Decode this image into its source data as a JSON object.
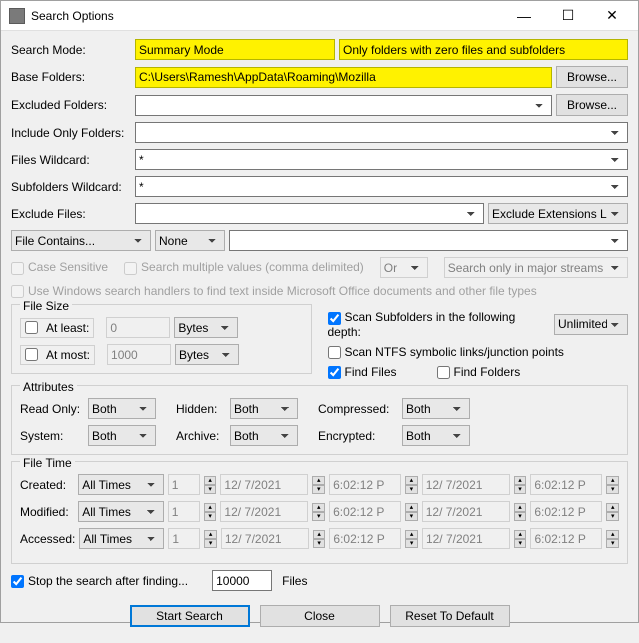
{
  "window": {
    "title": "Search Options"
  },
  "labels": {
    "search_mode": "Search Mode:",
    "base_folders": "Base Folders:",
    "excluded_folders": "Excluded Folders:",
    "include_only": "Include Only Folders:",
    "files_wildcard": "Files Wildcard:",
    "subfolders_wildcard": "Subfolders Wildcard:",
    "exclude_files": "Exclude Files:"
  },
  "search_mode": {
    "value": "Summary Mode",
    "filter": "Only folders with zero files and subfolders"
  },
  "base": {
    "path": "C:\\Users\\Ramesh\\AppData\\Roaming\\Mozilla",
    "browse": "Browse..."
  },
  "excluded": {
    "value": "",
    "browse": "Browse..."
  },
  "include_only": {
    "value": ""
  },
  "files_wildcard": {
    "value": "*"
  },
  "subfolders_wildcard": {
    "value": "*"
  },
  "exclude_files": {
    "value": "",
    "ext_list": "Exclude Extensions List"
  },
  "file_contains": {
    "label": "File Contains...",
    "match": "None",
    "value": ""
  },
  "opts": {
    "case_sensitive": "Case Sensitive",
    "multi_values": "Search multiple values (comma delimited)",
    "or": "Or",
    "major_streams": "Search only in major streams",
    "use_handlers": "Use Windows search handlers to find text inside Microsoft Office documents and other file types"
  },
  "filesize": {
    "legend": "File Size",
    "at_least": "At least:",
    "at_most": "At most:",
    "least_val": "0",
    "most_val": "1000",
    "unit": "Bytes"
  },
  "scan": {
    "subfolders": "Scan Subfolders in the following depth:",
    "depth": "Unlimited",
    "ntfs": "Scan NTFS symbolic links/junction points",
    "find_files": "Find Files",
    "find_folders": "Find Folders"
  },
  "attrs": {
    "legend": "Attributes",
    "read_only": "Read Only:",
    "hidden": "Hidden:",
    "compressed": "Compressed:",
    "system": "System:",
    "archive": "Archive:",
    "encrypted": "Encrypted:",
    "both": "Both"
  },
  "filetime": {
    "legend": "File Time",
    "created": "Created:",
    "modified": "Modified:",
    "accessed": "Accessed:",
    "all_times": "All Times",
    "count": "1",
    "date": "12/ 7/2021",
    "time": "6:02:12 P"
  },
  "stop": {
    "label": "Stop the search after finding...",
    "value": "10000",
    "unit": "Files"
  },
  "buttons": {
    "start": "Start Search",
    "close": "Close",
    "reset": "Reset To Default"
  }
}
